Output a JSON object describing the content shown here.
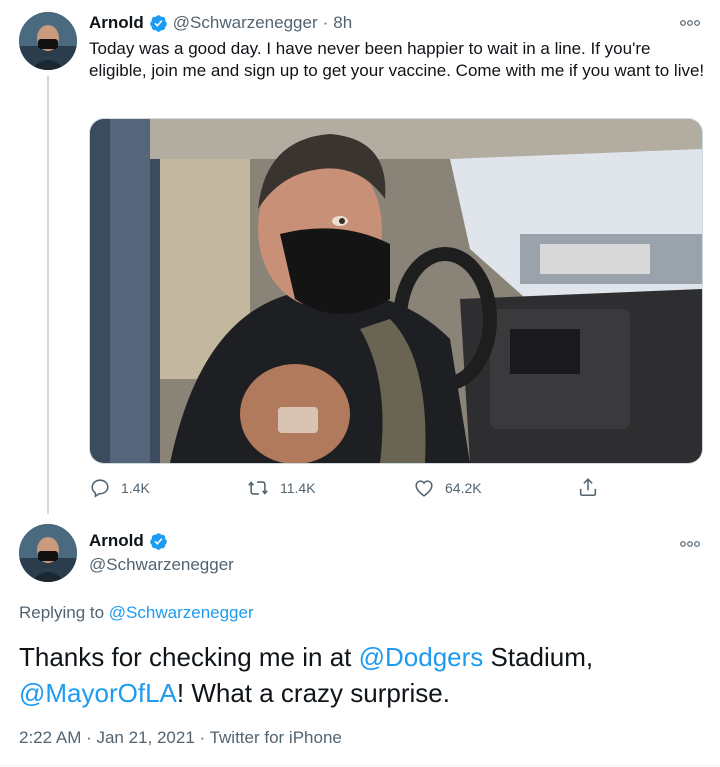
{
  "tweet1": {
    "author_name": "Arnold",
    "handle": "@Schwarzenegger",
    "separator": "·",
    "time": "8h",
    "text": "Today was a good day. I have never been happier to wait in a line. If you're eligible, join me and sign up to get your vaccine. Come with me if you want to live!",
    "stats": {
      "replies": "1.4K",
      "retweets": "11.4K",
      "likes": "64.2K"
    }
  },
  "tweet2": {
    "author_name": "Arnold",
    "handle": "@Schwarzenegger",
    "replying_prefix": "Replying to",
    "replying_handle": "@Schwarzenegger",
    "text_parts": {
      "p1": "Thanks for checking me in at ",
      "mention1": "@Dodgers",
      "p2": " Stadium,",
      "mention2": "@MayorOfLA",
      "p3": "! What a crazy surprise."
    },
    "timestamp": "2:22 AM · Jan 21, 2021 · Twitter for iPhone"
  },
  "colors": {
    "accent": "#1d9bf0",
    "muted": "#536471",
    "text": "#0f1419"
  },
  "icons": [
    "more-icon",
    "verified-badge-icon",
    "reply-icon",
    "retweet-icon",
    "like-icon",
    "share-icon"
  ]
}
